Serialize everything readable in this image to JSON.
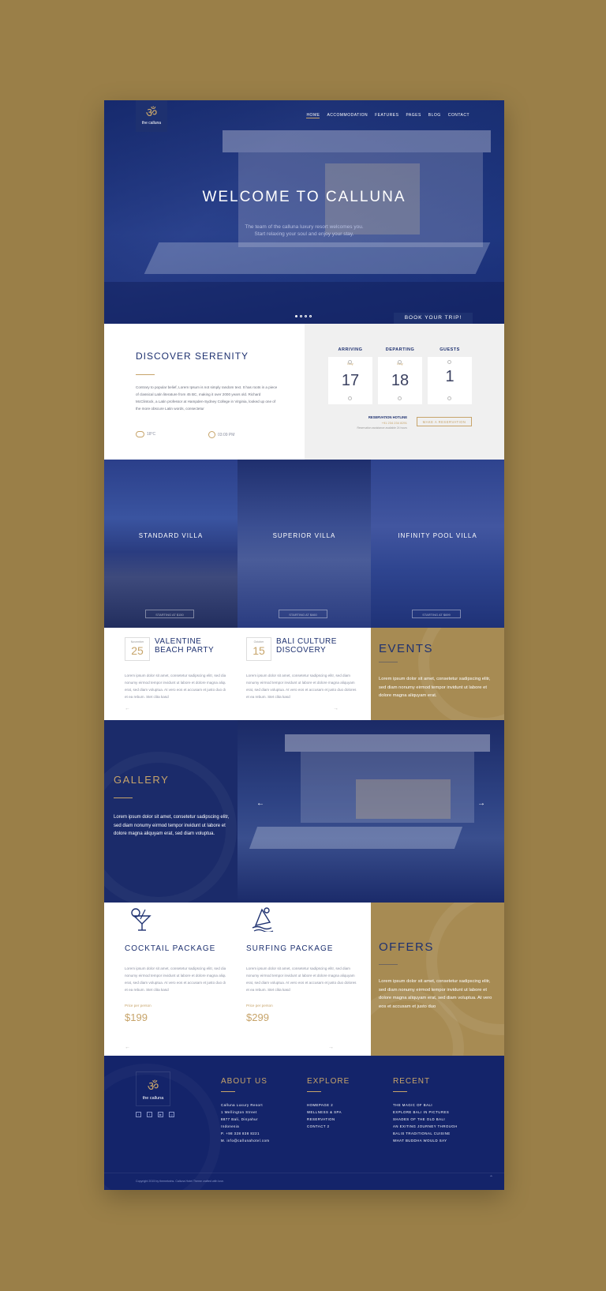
{
  "brand": {
    "name": "the calluna",
    "mark": "ॐ"
  },
  "nav": [
    "HOME",
    "ACCOMMODATION",
    "FEATURES",
    "PAGES",
    "BLOG",
    "CONTACT"
  ],
  "hero": {
    "title": "WELCOME TO CALLUNA",
    "subtitle_1": "The team of the calluna luxury resort welcomes you.",
    "subtitle_2": "Start relaxing your soul and enjoy your stay.",
    "book_button": "BOOK YOUR TRIP!",
    "slides": 4,
    "active_slide": 1
  },
  "discover": {
    "title": "DISCOVER SERENITY",
    "text": "Contrary to popular belief, Lorem Ipsum is not simply random text. It has roots in a piece of classical Latin literature from 45 BC, making it over 2000 years old. Richard McClintock, a Latin professor at Hampden-Sydney College in Virginia, looked up one of the more obscure Latin words, consectetur",
    "temperature": "18°C",
    "time": "03:09 PM"
  },
  "booking": {
    "arriving": {
      "label": "ARRIVING",
      "month": "May",
      "value": "17"
    },
    "departing": {
      "label": "DEPARTING",
      "month": "May",
      "value": "18"
    },
    "guests": {
      "label": "GUESTS",
      "value": "1"
    },
    "hotline_title": "RESERVATION HOTLINE",
    "hotline_phone": "+91 234 234 8291",
    "hotline_note": "Reservation assistance available 24 hours",
    "reserve_button": "MAKE A RESERVATION"
  },
  "villas": [
    {
      "title": "STANDARD VILLA",
      "button": "STARTING AT $150"
    },
    {
      "title": "SUPERIOR VILLA",
      "button": "STARTING AT $460"
    },
    {
      "title": "INFINITY POOL VILLA",
      "button": "STARTING AT $699"
    }
  ],
  "events": {
    "title": "EVENTS",
    "text": "Lorem ipsum dolor sit amet, consetetur sadipscing elitr, sed diam nonumy eirmod tempor invidunt ut labore et dolore magna aliquyam erat.",
    "items": [
      {
        "month": "November",
        "day": "25",
        "title_1": "VALENTINE",
        "title_2": "BEACH PARTY",
        "text": "Lorem ipsum dolor sit amet, consetetur sadipscing elitr, sed diam nonumy eirmod tempor invidunt ut labore et dolore magna aliquyam erat, sed diam voluptua. At vero eos et accusam et justo duo dolores et ea rebum. Stet clita kasd"
      },
      {
        "month": "October",
        "day": "15",
        "title_1": "BALI CULTURE",
        "title_2": "DISCOVERY",
        "text": "Lorem ipsum dolor sit amet, consetetur sadipscing elitr, sed diam nonumy eirmod tempor invidunt ut labore et dolore magna aliquyam erat, sed diam voluptua. At vero eos et accusam et justo duo dolores et ea rebum. Stet clita kasd"
      }
    ]
  },
  "gallery": {
    "title": "GALLERY",
    "text": "Lorem ipsum dolor sit amet, consetetur sadipscing elitr, sed diam nonumy eirmod tempor invidunt ut labore et dolore magna aliquyam erat, sed diam voluptua."
  },
  "packages": [
    {
      "title": "COCKTAIL PACKAGE",
      "icon": "cocktail-icon",
      "text": "Lorem ipsum dolor sit amet, consetetur sadipscing elitr, sed diam nonumy eirmod tempor invidunt ut labore et dolore magna aliquyam erat, sed diam voluptua. At vero eos et accusam et justo duo dolores et ea rebum. Stet clita kasd",
      "price_label": "Price per person",
      "price": "$199"
    },
    {
      "title": "SURFING PACKAGE",
      "icon": "surfing-icon",
      "text": "Lorem ipsum dolor sit amet, consetetur sadipscing elitr, sed diam nonumy eirmod tempor invidunt ut labore et dolore magna aliquyam erat, sed diam voluptua. At vero eos et accusam et justo duo dolores et ea rebum. Stet clita kasd",
      "price_label": "Price per person",
      "price": "$299"
    }
  ],
  "offers": {
    "title": "OFFERS",
    "text": "Lorem ipsum dolor sit amet, consetetur sadipscing elitr, sed diam nonumy eirmod tempor invidunt ut labore et dolore magna aliquyam erat, sed diam voluptua. At vero eos et accusam et justo duo"
  },
  "footer": {
    "about_title": "ABOUT US",
    "about": [
      "Calluna Luxury Resort",
      "1 Wellington Street",
      "8877 Bali, Dinyahur",
      "Indonesia",
      "P. +98 328 838 8221",
      "M. info@callunahotel.com"
    ],
    "explore_title": "EXPLORE",
    "explore": [
      "HOMEPAGE 2",
      "WELLNESS & SPA",
      "RESERVATION",
      "CONTACT 2"
    ],
    "recent_title": "RECENT",
    "recent": [
      "THE MAGIC OF BALI",
      "EXPLORE BALI IN PICTURES",
      "SHADES OF THE OLD BALI",
      "AN EXITING JOURNEY THROUGH",
      "BALIS TRADITIONAL CUISINE",
      "WHAT BUDDHA WOULD SAY"
    ],
    "copyright": "Copyright 2015 by themetwins. Calluna Hotel Theme crafted with love."
  }
}
